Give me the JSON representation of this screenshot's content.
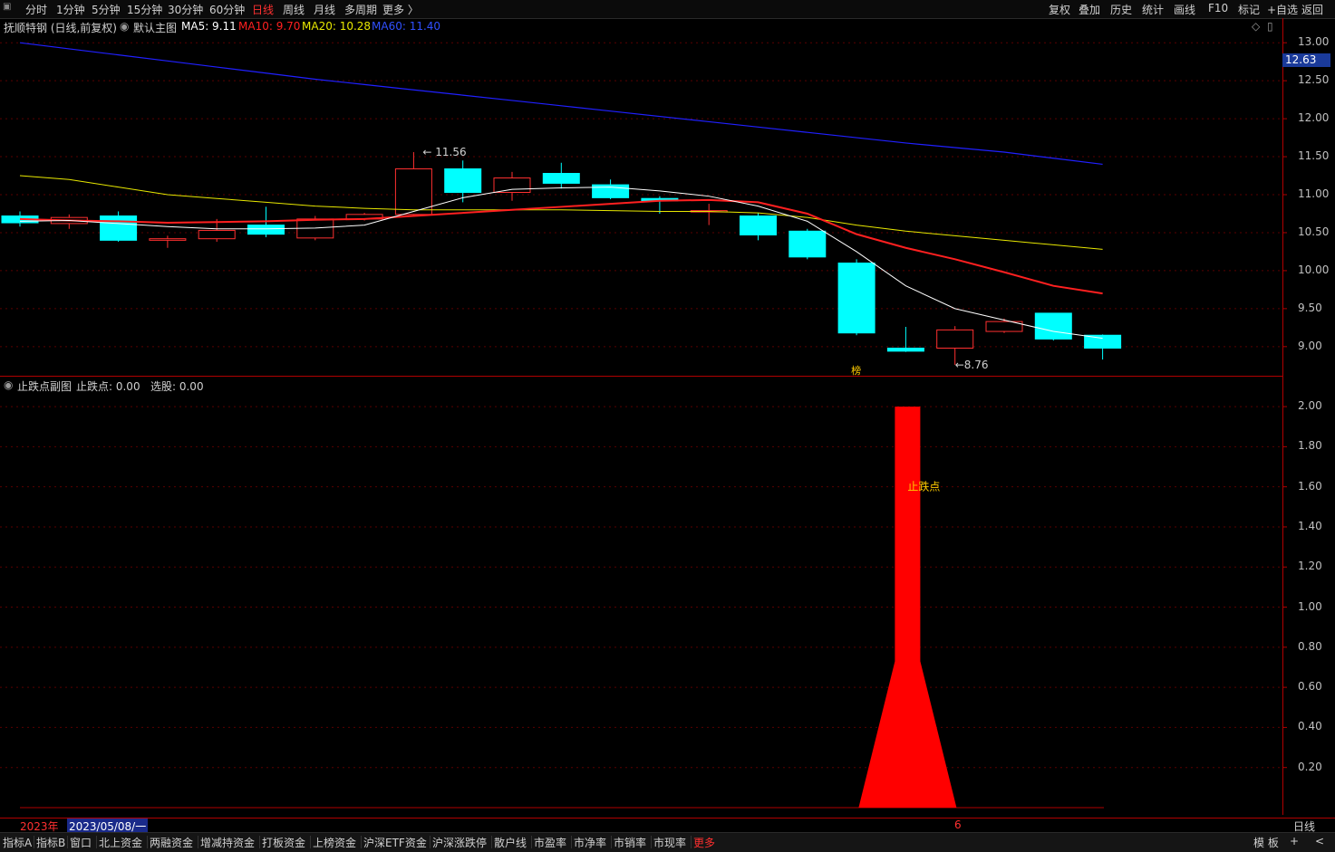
{
  "toolbar": {
    "icon": "window-icon",
    "periods": [
      "分时",
      "1分钟",
      "5分钟",
      "15分钟",
      "30分钟",
      "60分钟",
      "日线",
      "周线",
      "月线",
      "多周期",
      "更多 〉"
    ],
    "active_period": "日线",
    "right_buttons": [
      "复权",
      "叠加",
      "历史",
      "统计",
      "画线",
      "F10",
      "标记",
      "+自选",
      "返回"
    ]
  },
  "main_chart": {
    "stock": "抚顺特钢 (日线,前复权)",
    "indicator_name": "默认主图",
    "ma5": "MA5: 9.11",
    "ma10": "MA10: 9.70",
    "ma20": "MA20: 10.28",
    "ma60": "MA60: 11.40",
    "high_label": "11.56",
    "low_label": "8.76",
    "signal_label": "榜",
    "current_price": "12.63",
    "price_ticks": [
      "13.00",
      "12.50",
      "12.00",
      "11.50",
      "11.00",
      "10.50",
      "10.00",
      "9.50",
      "9.00"
    ]
  },
  "sub_chart": {
    "indicator_name": "止跌点副图",
    "value1": "止跌点: 0.00",
    "value2": "选股: 0.00",
    "bar_label": "止跌点",
    "ticks": [
      "2.00",
      "1.80",
      "1.60",
      "1.40",
      "1.20",
      "1.00",
      "0.80",
      "0.60",
      "0.40",
      "0.20"
    ]
  },
  "time_axis": {
    "year": "2023年",
    "cursor_date": "2023/05/08/一",
    "month_mark": "6",
    "period_label": "日线"
  },
  "bottom_tabs": [
    "指标A",
    "指标B",
    "窗口",
    "北上资金",
    "两融资金",
    "增减持资金",
    "打板资金",
    "上榜资金",
    "沪深ETF资金",
    "沪深涨跌停",
    "散户线",
    "市盈率",
    "市净率",
    "市销率",
    "市现率",
    "更多"
  ],
  "bottom_right": [
    "模 板",
    "+",
    "<"
  ],
  "colors": {
    "up": "#ff3030",
    "down": "#00ffff",
    "ma5": "#ffffff",
    "ma10": "#ff2020",
    "ma20": "#e8e800",
    "ma60": "#2020ff",
    "frame": "#b00000"
  },
  "chart_data": {
    "type": "candlestick",
    "ylim": [
      8.7,
      13.05
    ],
    "candles": [
      {
        "o": 10.72,
        "c": 10.63,
        "h": 10.78,
        "l": 10.58
      },
      {
        "o": 10.62,
        "c": 10.7,
        "h": 10.74,
        "l": 10.55
      },
      {
        "o": 10.72,
        "c": 10.4,
        "h": 10.78,
        "l": 10.38
      },
      {
        "o": 10.4,
        "c": 10.42,
        "h": 10.46,
        "l": 10.3
      },
      {
        "o": 10.42,
        "c": 10.53,
        "h": 10.68,
        "l": 10.38
      },
      {
        "o": 10.6,
        "c": 10.48,
        "h": 10.84,
        "l": 10.44
      },
      {
        "o": 10.43,
        "c": 10.68,
        "h": 10.72,
        "l": 10.4
      },
      {
        "o": 10.68,
        "c": 10.74,
        "h": 10.76,
        "l": 10.66
      },
      {
        "o": 10.74,
        "c": 11.34,
        "h": 11.56,
        "l": 10.72
      },
      {
        "o": 11.34,
        "c": 11.03,
        "h": 11.45,
        "l": 10.9
      },
      {
        "o": 11.03,
        "c": 11.22,
        "h": 11.3,
        "l": 10.92
      },
      {
        "o": 11.28,
        "c": 11.15,
        "h": 11.42,
        "l": 11.08
      },
      {
        "o": 11.13,
        "c": 10.96,
        "h": 11.2,
        "l": 10.94
      },
      {
        "o": 10.95,
        "c": 10.92,
        "h": 10.98,
        "l": 10.75
      },
      {
        "o": 10.79,
        "c": 10.79,
        "h": 10.88,
        "l": 10.6
      },
      {
        "o": 10.72,
        "c": 10.47,
        "h": 10.76,
        "l": 10.4
      },
      {
        "o": 10.52,
        "c": 10.18,
        "h": 10.55,
        "l": 10.15
      },
      {
        "o": 10.1,
        "c": 9.18,
        "h": 10.15,
        "l": 9.15
      },
      {
        "o": 8.98,
        "c": 8.94,
        "h": 9.26,
        "l": 8.93
      },
      {
        "o": 8.98,
        "c": 9.22,
        "h": 9.27,
        "l": 8.76
      },
      {
        "o": 9.2,
        "c": 9.33,
        "h": 9.37,
        "l": 9.18
      },
      {
        "o": 9.44,
        "c": 9.1,
        "h": 9.44,
        "l": 9.08
      },
      {
        "o": 9.15,
        "c": 8.98,
        "h": 9.16,
        "l": 8.83
      }
    ],
    "ma5": [
      10.65,
      10.66,
      10.62,
      10.58,
      10.55,
      10.55,
      10.56,
      10.6,
      10.78,
      10.96,
      11.07,
      11.09,
      11.1,
      11.05,
      10.98,
      10.85,
      10.65,
      10.25,
      9.8,
      9.5,
      9.35,
      9.2,
      9.11
    ],
    "ma10": [
      10.68,
      10.66,
      10.65,
      10.63,
      10.64,
      10.65,
      10.67,
      10.68,
      10.72,
      10.76,
      10.8,
      10.84,
      10.88,
      10.92,
      10.93,
      10.9,
      10.75,
      10.48,
      10.3,
      10.15,
      9.98,
      9.8,
      9.7
    ],
    "ma20": [
      11.25,
      11.2,
      11.1,
      11.0,
      10.95,
      10.9,
      10.85,
      10.82,
      10.8,
      10.8,
      10.8,
      10.8,
      10.79,
      10.78,
      10.78,
      10.76,
      10.7,
      10.6,
      10.52,
      10.46,
      10.4,
      10.34,
      10.28
    ],
    "ma60": [
      13.0,
      12.92,
      12.84,
      12.76,
      12.68,
      12.6,
      12.52,
      12.45,
      12.38,
      12.31,
      12.24,
      12.17,
      12.1,
      12.03,
      11.96,
      11.89,
      11.82,
      11.75,
      11.68,
      11.62,
      11.56,
      11.48,
      11.4
    ],
    "sub_bar": {
      "ylim": [
        0,
        2.05
      ],
      "peak": 2.0,
      "shoulder": 0.73
    }
  }
}
